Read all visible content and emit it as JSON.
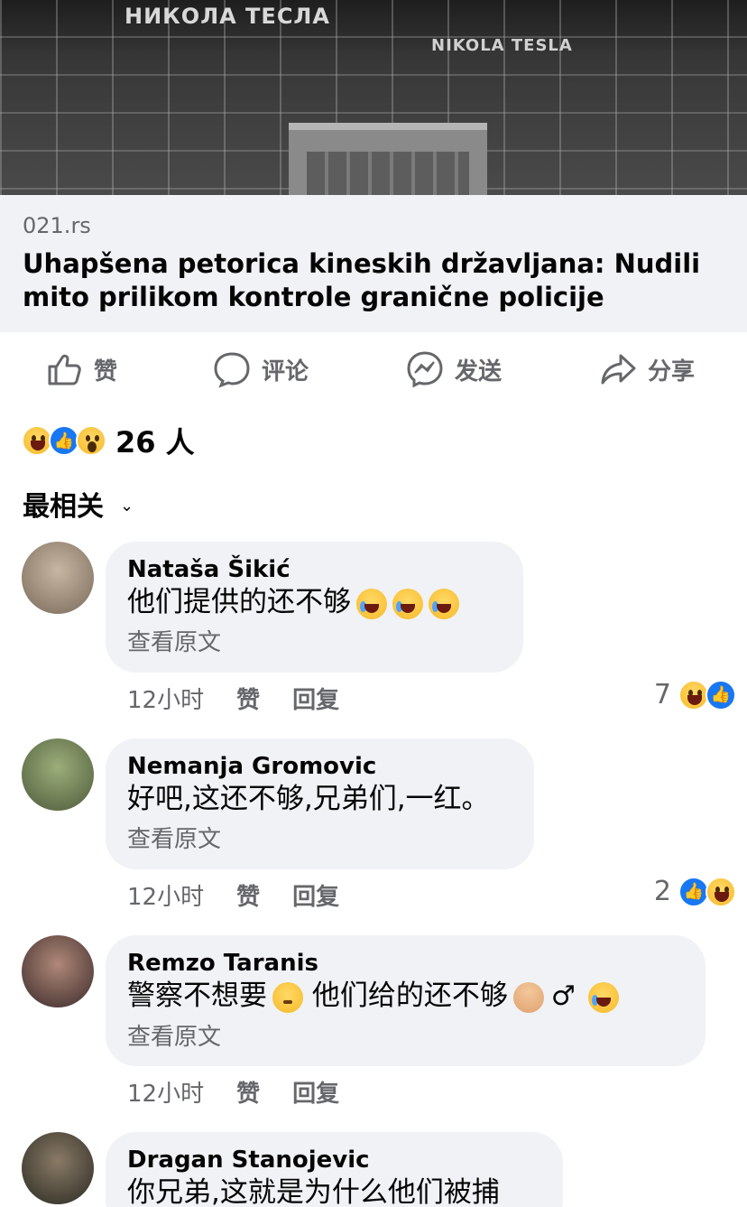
{
  "hero": {
    "sign_cyrillic": "НИКОЛА ТЕСЛА",
    "sign_latin": "NIKOLA TESLA"
  },
  "preview": {
    "domain": "021.rs",
    "headline": "Uhapšena petorica kineskih državljana: Nudili mito prilikom kontrole granične policije"
  },
  "actions": [
    {
      "label": "赞",
      "icon": "like-icon"
    },
    {
      "label": "评论",
      "icon": "comment-icon"
    },
    {
      "label": "发送",
      "icon": "messenger-icon"
    },
    {
      "label": "分享",
      "icon": "share-icon"
    }
  ],
  "summary": {
    "reactions": [
      "haha",
      "like",
      "wow"
    ],
    "count": "26 人"
  },
  "sort": {
    "label": "最相关"
  },
  "comments": [
    {
      "author": "Nataša Šikić",
      "text": "他们提供的还不够",
      "emoji_suffix": [
        "tears-of-joy",
        "tears-of-joy",
        "tears-of-joy"
      ],
      "see_original": "查看原文",
      "time": "12小时",
      "like": "赞",
      "reply": "回复",
      "reaction_count": "7",
      "reactions": [
        "haha",
        "like"
      ]
    },
    {
      "author": "Nemanja Gromovic",
      "text": "好吧,这还不够,兄弟们,一红。",
      "see_original": "查看原文",
      "time": "12小时",
      "like": "赞",
      "reply": "回复",
      "reaction_count": "2",
      "reactions": [
        "like",
        "haha"
      ]
    },
    {
      "author": "Remzo Taranis",
      "text_a": "警察不想要",
      "text_b": "他们给的还不够",
      "male_sign": "♂",
      "see_original": "查看原文",
      "time": "12小时",
      "like": "赞",
      "reply": "回复"
    },
    {
      "author": "Dragan Stanojevic",
      "text": "你兄弟,这就是为什么他们被捕"
    }
  ],
  "colors": {
    "bubble": "#f0f2f5",
    "secondary_text": "#65676b",
    "like_blue": "#1877f2",
    "haha_yellow": "#f7b928"
  }
}
